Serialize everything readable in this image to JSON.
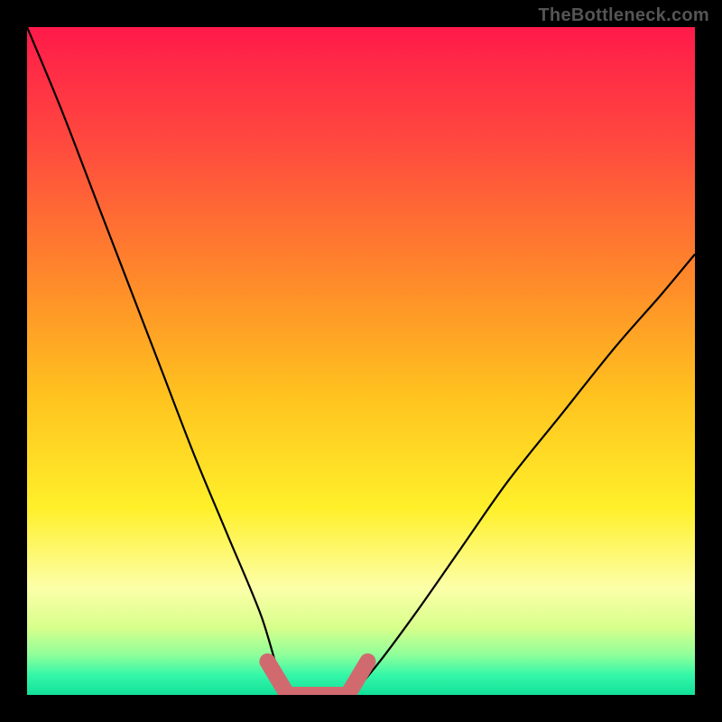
{
  "watermark": "TheBottleneck.com",
  "chart_data": {
    "type": "line",
    "title": "",
    "xlabel": "",
    "ylabel": "",
    "xlim": [
      0,
      1
    ],
    "ylim": [
      0,
      1
    ],
    "grid": false,
    "series": [
      {
        "name": "bottleneck-curve",
        "description": "V-shaped bottleneck curve; y is bottleneck magnitude (1=worst, 0=none). Minimum (flat zero) around x ≈ 0.39–0.48.",
        "x": [
          0.0,
          0.05,
          0.1,
          0.15,
          0.2,
          0.25,
          0.3,
          0.35,
          0.39,
          0.43,
          0.48,
          0.52,
          0.58,
          0.65,
          0.72,
          0.8,
          0.88,
          0.95,
          1.0
        ],
        "values": [
          1.0,
          0.88,
          0.75,
          0.62,
          0.49,
          0.36,
          0.24,
          0.12,
          0.0,
          0.0,
          0.0,
          0.04,
          0.12,
          0.22,
          0.32,
          0.42,
          0.52,
          0.6,
          0.66
        ]
      },
      {
        "name": "optimal-band-marker",
        "description": "Thick pink segment marking the flat optimal zone at y≈0.",
        "x": [
          0.36,
          0.39,
          0.43,
          0.48,
          0.51
        ],
        "values": [
          0.05,
          0.0,
          0.0,
          0.0,
          0.05
        ]
      }
    ],
    "background_gradient": {
      "type": "vertical",
      "stops": [
        {
          "pos": 0.0,
          "color": "#ff1a4a"
        },
        {
          "pos": 0.18,
          "color": "#ff4b3e"
        },
        {
          "pos": 0.38,
          "color": "#ff8a2a"
        },
        {
          "pos": 0.55,
          "color": "#ffc21f"
        },
        {
          "pos": 0.72,
          "color": "#fff02a"
        },
        {
          "pos": 0.84,
          "color": "#fcffa8"
        },
        {
          "pos": 0.9,
          "color": "#d7ff8c"
        },
        {
          "pos": 0.94,
          "color": "#8fff9a"
        },
        {
          "pos": 0.97,
          "color": "#35f7a8"
        },
        {
          "pos": 1.0,
          "color": "#12e09a"
        }
      ]
    },
    "colors": {
      "curve": "#000000",
      "marker": "#d06a6f",
      "frame": "#000000"
    }
  }
}
